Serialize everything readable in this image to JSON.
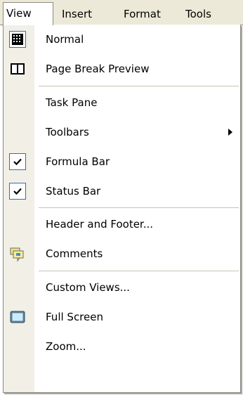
{
  "menubar": {
    "view": "View",
    "insert": "Insert",
    "format": "Format",
    "tools": "Tools"
  },
  "menu": {
    "items": [
      {
        "label": "Normal",
        "icon": "grid-view-icon"
      },
      {
        "label": "Page Break Preview",
        "icon": "page-break-preview-icon"
      },
      {
        "label": "Task Pane"
      },
      {
        "label": "Toolbars",
        "submenu": true
      },
      {
        "label": "Formula Bar",
        "checked": true
      },
      {
        "label": "Status Bar",
        "checked": true
      },
      {
        "label": "Header and Footer..."
      },
      {
        "label": "Comments",
        "icon": "comments-icon"
      },
      {
        "label": "Custom Views..."
      },
      {
        "label": "Full Screen",
        "icon": "full-screen-icon"
      },
      {
        "label": "Zoom..."
      }
    ]
  }
}
